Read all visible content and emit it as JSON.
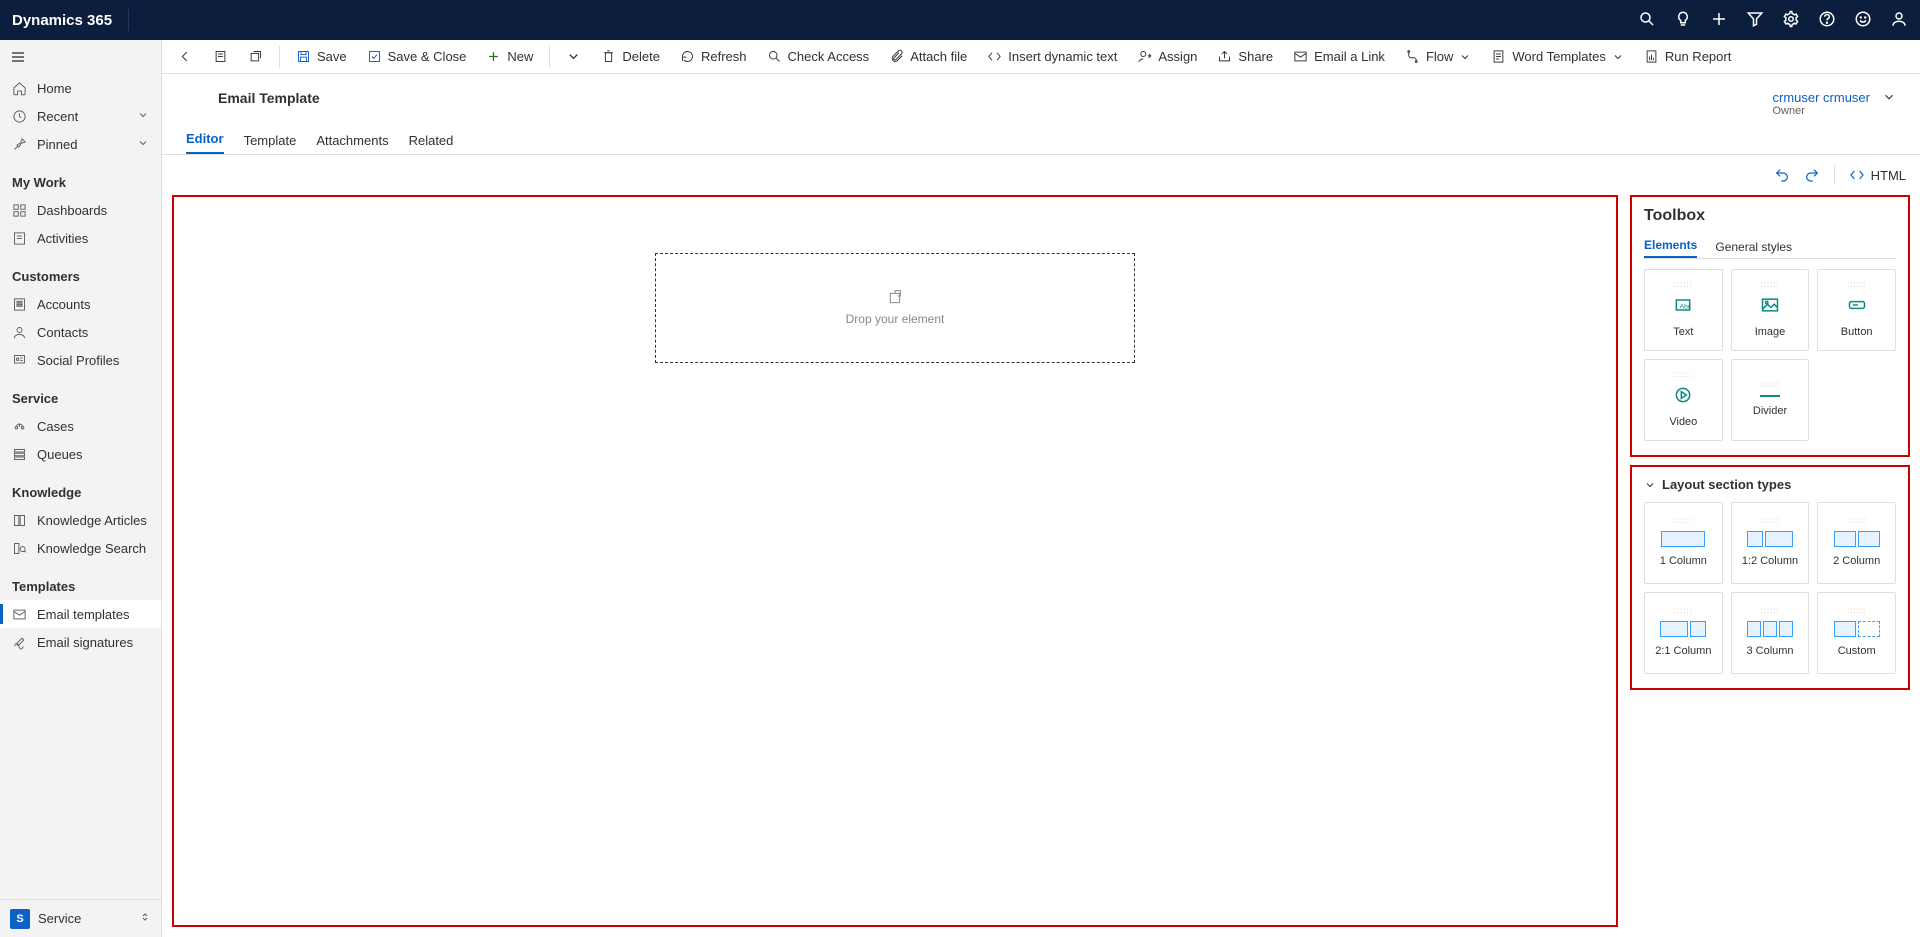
{
  "titlebar": {
    "brand": "Dynamics 365"
  },
  "sidebar": {
    "items": [
      {
        "label": "Home"
      },
      {
        "label": "Recent"
      },
      {
        "label": "Pinned"
      }
    ],
    "groups": {
      "mywork": {
        "title": "My Work",
        "items": [
          {
            "label": "Dashboards"
          },
          {
            "label": "Activities"
          }
        ]
      },
      "customers": {
        "title": "Customers",
        "items": [
          {
            "label": "Accounts"
          },
          {
            "label": "Contacts"
          },
          {
            "label": "Social Profiles"
          }
        ]
      },
      "service": {
        "title": "Service",
        "items": [
          {
            "label": "Cases"
          },
          {
            "label": "Queues"
          }
        ]
      },
      "knowledge": {
        "title": "Knowledge",
        "items": [
          {
            "label": "Knowledge Articles"
          },
          {
            "label": "Knowledge Search"
          }
        ]
      },
      "templates": {
        "title": "Templates",
        "items": [
          {
            "label": "Email templates"
          },
          {
            "label": "Email signatures"
          }
        ]
      }
    },
    "footer": {
      "appInitial": "S",
      "appName": "Service"
    }
  },
  "cmdbar": {
    "save": "Save",
    "saveClose": "Save & Close",
    "new": "New",
    "delete": "Delete",
    "refresh": "Refresh",
    "checkAccess": "Check Access",
    "attachFile": "Attach file",
    "insertDynamic": "Insert dynamic text",
    "assign": "Assign",
    "share": "Share",
    "emailLink": "Email a Link",
    "flow": "Flow",
    "wordTemplates": "Word Templates",
    "runReport": "Run Report"
  },
  "record": {
    "title": "Email Template",
    "owner": {
      "name": "crmuser crmuser",
      "label": "Owner"
    },
    "tabs": [
      "Editor",
      "Template",
      "Attachments",
      "Related"
    ]
  },
  "editorActions": {
    "html": "HTML"
  },
  "canvas": {
    "dropHint": "Drop your element"
  },
  "toolbox": {
    "title": "Toolbox",
    "tabs": [
      "Elements",
      "General styles"
    ],
    "elements": [
      {
        "label": "Text"
      },
      {
        "label": "Image"
      },
      {
        "label": "Button"
      },
      {
        "label": "Video"
      },
      {
        "label": "Divider"
      }
    ]
  },
  "layout": {
    "title": "Layout section types",
    "items": [
      {
        "label": "1 Column"
      },
      {
        "label": "1:2 Column"
      },
      {
        "label": "2 Column"
      },
      {
        "label": "2:1 Column"
      },
      {
        "label": "3 Column"
      },
      {
        "label": "Custom"
      }
    ]
  }
}
